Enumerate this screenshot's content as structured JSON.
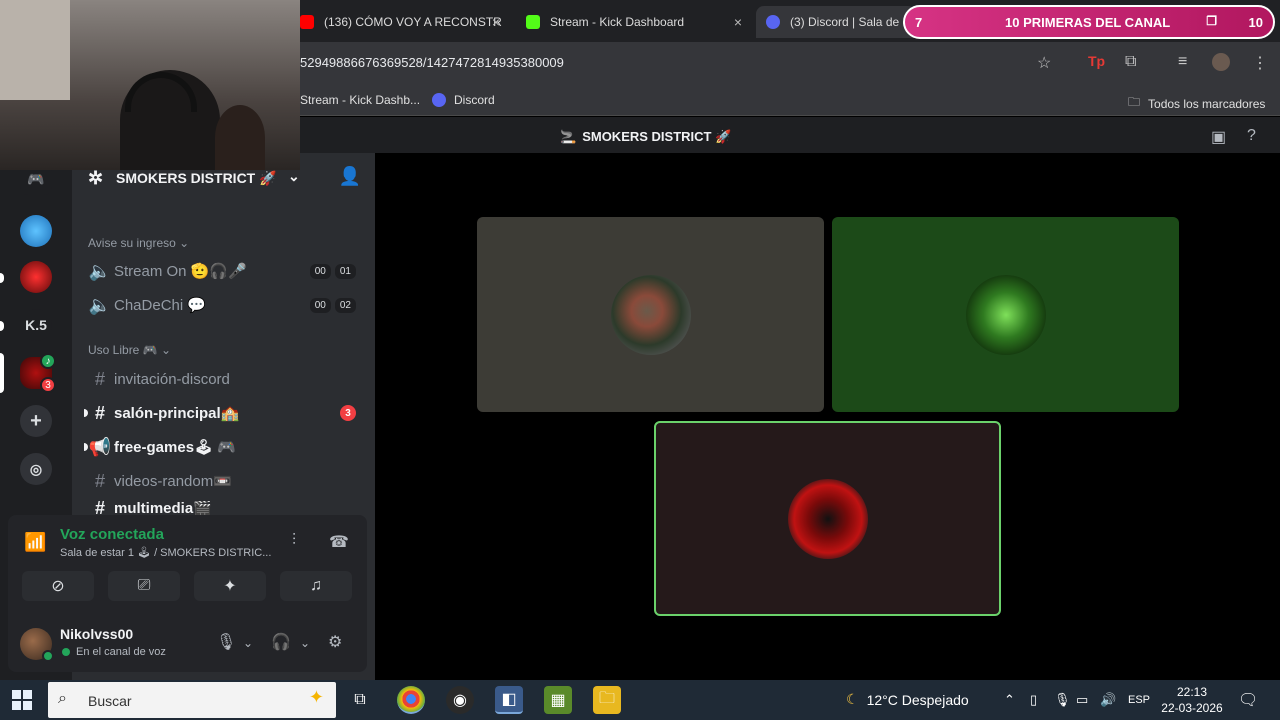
{
  "browser": {
    "tabs": [
      {
        "title": "(136) CÓMO VOY A RECONSTR",
        "color": "#ff0000",
        "icon": "youtube-icon"
      },
      {
        "title": "Stream - Kick Dashboard",
        "color": "#53fc18",
        "icon": "kick-icon"
      },
      {
        "title": "(3) Discord | Sala de es",
        "color": "#5865f2",
        "icon": "discord-icon"
      }
    ],
    "close_glyph": "×",
    "url": "5294988667636952​8/1427472814935380009",
    "bookmarks": [
      {
        "label": "Stream - Kick Dashb..."
      },
      {
        "label": "Discord"
      }
    ],
    "all_bookmarks": "Todos los marcadores"
  },
  "overlay": {
    "left_number": "7",
    "title": "10 PRIMERAS DEL CANAL",
    "right_number": "10",
    "restore_icon": "❐"
  },
  "discord": {
    "window_title": "SMOKERS DISTRICT 🚀",
    "window_title_prefix": "🚬",
    "server": {
      "name": "SMOKERS DISTRICT 🚀"
    },
    "guild_labels": {
      "k5": "K.5"
    },
    "guild_badge": "3",
    "categories": {
      "avise": "Avise su ingreso ⌄",
      "uso": "Uso Libre 🎮 ⌄"
    },
    "voice_channels": [
      {
        "name": "Stream On 🫡🎧🎤",
        "count_a": "00",
        "count_b": "01"
      },
      {
        "name": "ChaDeChi 💬",
        "count_a": "00",
        "count_b": "02"
      }
    ],
    "text_channels": [
      {
        "name": "invitación-discord",
        "icon": "#"
      },
      {
        "name": "salón-principal🏫",
        "icon": "#",
        "mention": "3"
      },
      {
        "name": "free-games🕹 🎮",
        "icon": "📢"
      },
      {
        "name": "videos-random📼",
        "icon": "#"
      },
      {
        "name": "multimedia🎬",
        "icon": "#"
      }
    ],
    "voice_panel": {
      "status": "Voz conectada",
      "location": "Sala de estar 1 🕹 / SMOKERS DISTRIC..."
    },
    "user": {
      "name": "Nikolvss00",
      "status": "En el canal de voz"
    }
  },
  "taskbar": {
    "search_placeholder": "Buscar",
    "weather": "12°C  Despejado",
    "language": "ESP",
    "time": "22:13",
    "date": "22-03-2026"
  }
}
